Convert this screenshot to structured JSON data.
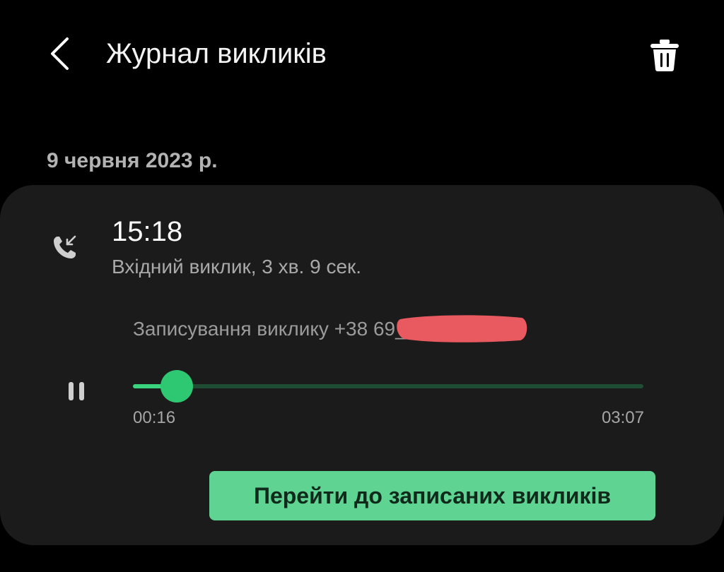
{
  "header": {
    "title": "Журнал викликів",
    "back_icon": "chevron-left-icon",
    "delete_icon": "trash-icon"
  },
  "date_label": "9 червня 2023 р.",
  "call": {
    "icon": "incoming-call-icon",
    "time": "15:18",
    "detail": "Вхідний виклик, 3 хв. 9 сек."
  },
  "recording": {
    "name": "Записування виклику +38          69_230609…",
    "pause_icon": "pause-icon",
    "current_time": "00:16",
    "total_time": "03:07",
    "progress": 0.0856
  },
  "actions": {
    "go_to_recordings_label": "Перейти до записаних викликів"
  },
  "colors": {
    "background": "#000000",
    "card": "#1b1b1b",
    "accent": "#2fc872",
    "track": "#1f4d33",
    "button": "#5fd492",
    "redaction": "#e85a5f"
  }
}
